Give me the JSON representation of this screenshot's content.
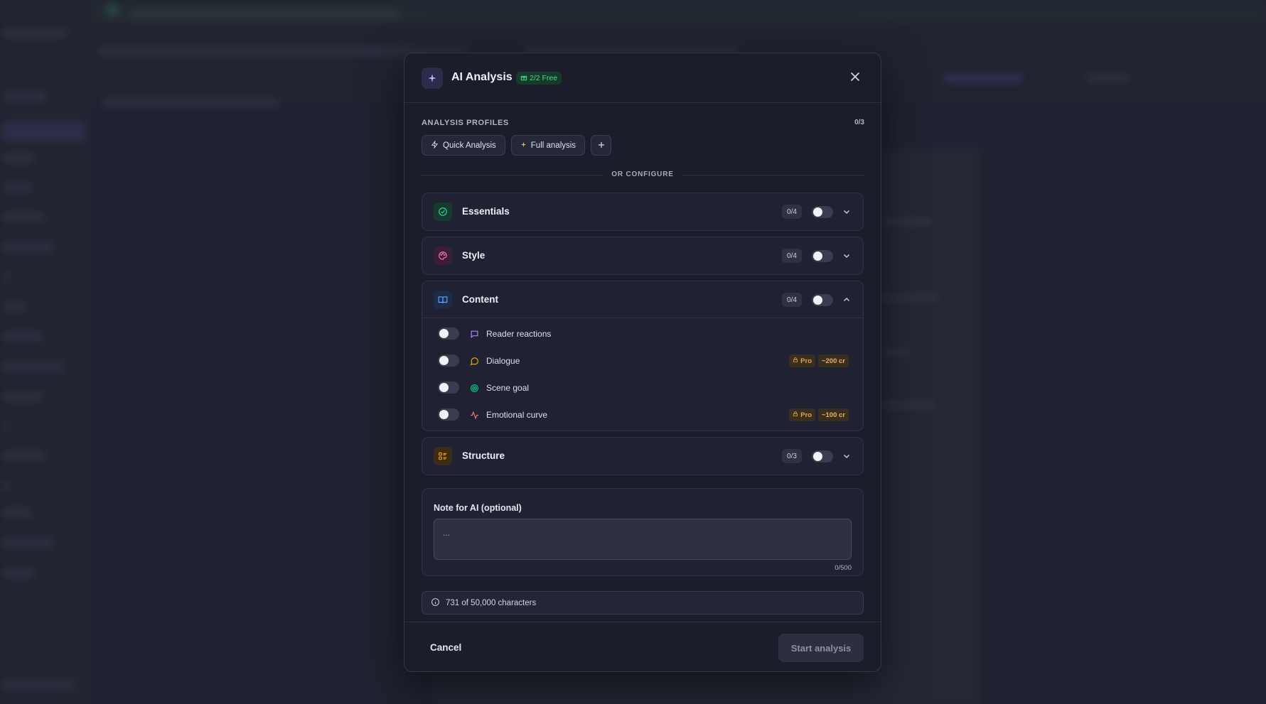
{
  "modal": {
    "title": "AI Analysis",
    "free_badge": "2/2 Free",
    "profiles_label": "ANALYSIS PROFILES",
    "profiles_count": "0/3",
    "profiles": [
      {
        "label": "Quick Analysis",
        "icon": "lightning-icon"
      },
      {
        "label": "Full analysis",
        "icon": "sparkle-icon"
      }
    ],
    "divider_text": "OR CONFIGURE",
    "categories": [
      {
        "name": "Essentials",
        "count": "0/4",
        "icon": "check-circle-icon",
        "color": "#34d399",
        "expanded": false
      },
      {
        "name": "Style",
        "count": "0/4",
        "icon": "palette-icon",
        "color": "#f472b6",
        "expanded": false
      },
      {
        "name": "Content",
        "count": "0/4",
        "icon": "book-icon",
        "color": "#60a5fa",
        "expanded": true,
        "items": [
          {
            "label": "Reader reactions",
            "icon": "message-square-icon",
            "color": "#a78bfa"
          },
          {
            "label": "Dialogue",
            "icon": "message-circle-icon",
            "color": "#f59e0b",
            "pro": "Pro",
            "cost": "~200 cr"
          },
          {
            "label": "Scene goal",
            "icon": "target-icon",
            "color": "#10b981"
          },
          {
            "label": "Emotional curve",
            "icon": "activity-icon",
            "color": "#f87171",
            "pro": "Pro",
            "cost": "~100 cr"
          }
        ]
      },
      {
        "name": "Structure",
        "count": "0/3",
        "icon": "layout-list-icon",
        "color": "#f59e0b",
        "expanded": false
      }
    ],
    "note": {
      "label": "Note for AI (optional)",
      "placeholder": "...",
      "value": "",
      "char_count": "0/500"
    },
    "info": "731 of 50,000 characters",
    "cancel_label": "Cancel",
    "start_label": "Start analysis"
  },
  "colors": {
    "modal_bg": "#1c1d2b",
    "accent_purple": "#c4b5fd",
    "free_green": "#4ade80",
    "pro_amber": "#e0a24a"
  }
}
